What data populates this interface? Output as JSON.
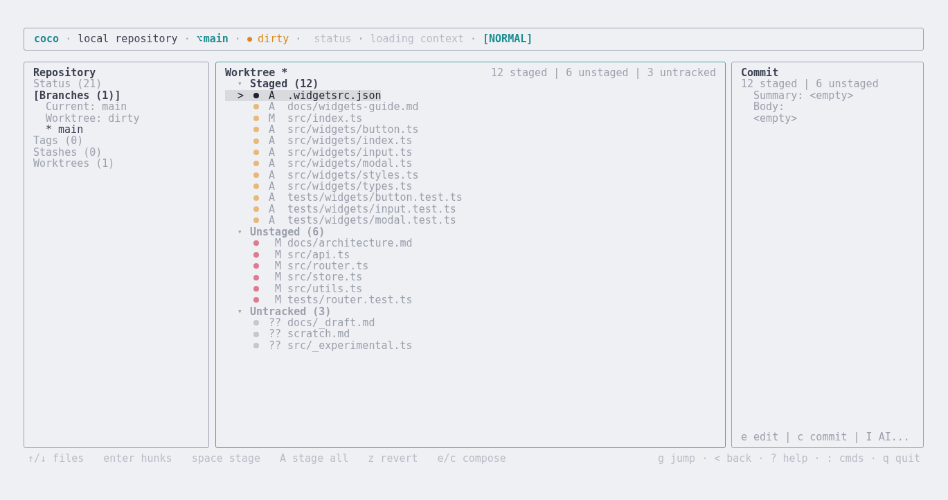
{
  "header": {
    "separator": "·",
    "items": [
      {
        "kind": "app",
        "text": "coco"
      },
      {
        "kind": "plain",
        "text": "local repository"
      },
      {
        "kind": "branch",
        "icon": "⌥",
        "text": "main"
      },
      {
        "kind": "dirty",
        "icon": "●",
        "text": "dirty"
      },
      {
        "kind": "muted",
        "text": "status"
      },
      {
        "kind": "muted",
        "text": "loading context"
      },
      {
        "kind": "mode",
        "text": "[NORMAL]"
      }
    ]
  },
  "repository": {
    "title": "Repository",
    "items": [
      {
        "label": "Status (21)",
        "selected": false
      },
      {
        "label": "[Branches (1)]",
        "selected": true,
        "children": [
          {
            "kind": "info",
            "label": "Current: main"
          },
          {
            "kind": "info",
            "label": "Worktree: dirty"
          },
          {
            "kind": "branch",
            "label": "* main"
          }
        ]
      },
      {
        "label": "Tags (0)",
        "selected": false
      },
      {
        "label": "Stashes (0)",
        "selected": false
      },
      {
        "label": "Worktrees (1)",
        "selected": false
      }
    ]
  },
  "worktree": {
    "title": "Worktree *",
    "summary": "12 staged | 6 unstaged | 3 untracked",
    "cursor": ">",
    "groups": [
      {
        "kind": "staged",
        "toggle": "▾",
        "label": "Staged (12)",
        "expanded": true,
        "color": "#e8b87a",
        "files": [
          {
            "status": "A",
            "path": ".widgetsrc.json",
            "selected": true
          },
          {
            "status": "A",
            "path": "docs/widgets-guide.md",
            "selected": false
          },
          {
            "status": "M",
            "path": "src/index.ts",
            "selected": false
          },
          {
            "status": "A",
            "path": "src/widgets/button.ts",
            "selected": false
          },
          {
            "status": "A",
            "path": "src/widgets/index.ts",
            "selected": false
          },
          {
            "status": "A",
            "path": "src/widgets/input.ts",
            "selected": false
          },
          {
            "status": "A",
            "path": "src/widgets/modal.ts",
            "selected": false
          },
          {
            "status": "A",
            "path": "src/widgets/styles.ts",
            "selected": false
          },
          {
            "status": "A",
            "path": "src/widgets/types.ts",
            "selected": false
          },
          {
            "status": "A",
            "path": "tests/widgets/button.test.ts",
            "selected": false
          },
          {
            "status": "A",
            "path": "tests/widgets/input.test.ts",
            "selected": false
          },
          {
            "status": "A",
            "path": "tests/widgets/modal.test.ts",
            "selected": false
          }
        ]
      },
      {
        "kind": "unstaged",
        "toggle": "▾",
        "label": "Unstaged (6)",
        "expanded": true,
        "color": "#e07a90",
        "files": [
          {
            "status": "M",
            "path": "docs/architecture.md",
            "selected": false
          },
          {
            "status": "M",
            "path": "src/api.ts",
            "selected": false
          },
          {
            "status": "M",
            "path": "src/router.ts",
            "selected": false
          },
          {
            "status": "M",
            "path": "src/store.ts",
            "selected": false
          },
          {
            "status": "M",
            "path": "src/utils.ts",
            "selected": false
          },
          {
            "status": "M",
            "path": "tests/router.test.ts",
            "selected": false
          }
        ]
      },
      {
        "kind": "untracked",
        "toggle": "▾",
        "label": "Untracked (3)",
        "expanded": true,
        "color": "#c4c7ce",
        "files": [
          {
            "status": "??",
            "path": "docs/_draft.md",
            "selected": false
          },
          {
            "status": "??",
            "path": "scratch.md",
            "selected": false
          },
          {
            "status": "??",
            "path": "src/_experimental.ts",
            "selected": false
          }
        ]
      }
    ]
  },
  "commit": {
    "title": "Commit",
    "summary": "12 staged | 6 unstaged",
    "lines": [
      "Summary: <empty>",
      "Body:",
      "<empty>"
    ],
    "hint": "e edit | c commit | I AI..."
  },
  "footer": {
    "left": [
      "↑/↓ files",
      "enter hunks",
      "space stage",
      "A stage all",
      "z revert",
      "e/c compose"
    ],
    "separator": "·",
    "right": [
      "g jump",
      "< back",
      "? help",
      ": cmds",
      "q quit"
    ]
  }
}
